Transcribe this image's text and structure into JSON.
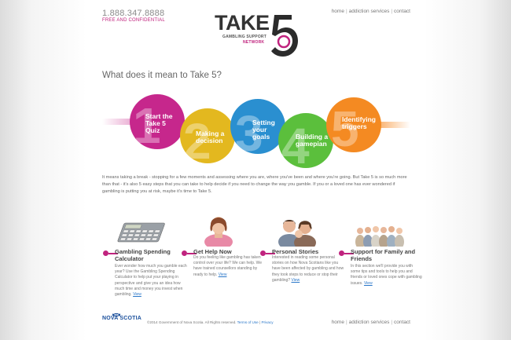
{
  "header": {
    "phone": "1.888.347.8888",
    "phone_sub": "FREE AND CONFIDENTIAL",
    "nav": [
      {
        "label": "home"
      },
      {
        "label": "addiction services"
      },
      {
        "label": "contact"
      }
    ],
    "logo": {
      "take": "TAKE",
      "five": "5",
      "sub1": "GAMBLING SUPPORT",
      "sub2": "NETWORK"
    }
  },
  "main": {
    "heading": "What does it mean to Take 5?",
    "steps": [
      {
        "number": "1",
        "label": "Start the Take 5 Quiz",
        "color": "#c6278c"
      },
      {
        "number": "2",
        "label": "Making a decision",
        "color": "#e3b81f"
      },
      {
        "number": "3",
        "label": "Setting your goals",
        "color": "#2a8fd0"
      },
      {
        "number": "4",
        "label": "Building a gamepian",
        "color": "#5bbf3c"
      },
      {
        "number": "5",
        "label": "Identifying triggers",
        "color": "#f48a22"
      }
    ],
    "intro": "It means taking a break - stopping for a few moments and assessing where you are, where you've been and where you're going. But Take 5 is so much more than that - it's also 5 easy steps that you can take to help decide if you need to change the way you gamble. If you or a loved one has ever wondered if gambling is putting you at risk, maybe it's time to Take 5.",
    "features": [
      {
        "title": "Gambling Spending Calculator",
        "body": "Ever wonder how much you gamble each year? Use the Gambling Spending Calculator to help put your playing in perspective and give you an idea how much time and money you invest when gambling.",
        "view": "View",
        "icon": "calculator-icon"
      },
      {
        "title": "Get Help Now",
        "body": "Do you feeling like gambling has taken control over your life? We can help. We have trained counsellors standing by ready to help.",
        "view": "View",
        "icon": "counsellor-photo"
      },
      {
        "title": "Personal Stories",
        "body": "Interested in reading some personal stories on how Nova Scotians like you have been affected by gambling and how they took steps to reduce or stop their gambling?",
        "view": "View",
        "icon": "family-photo"
      },
      {
        "title": "Support for Family and Friends",
        "body": "In this section we'll provide you with some tips and tools to help you and friends or loved ones cope with gambling issues.",
        "view": "View",
        "icon": "group-photo"
      }
    ]
  },
  "footer": {
    "logo": "NOVA SCOTIA",
    "copyright": "©2014 Government of Nova Scotia. All Rights reserved.",
    "terms": "Terms of Use",
    "privacy": "Privacy",
    "nav": [
      {
        "label": "home"
      },
      {
        "label": "addiction services"
      },
      {
        "label": "contact"
      }
    ]
  },
  "colors": {
    "accent": "#c0237e",
    "link": "#2a77c9"
  }
}
